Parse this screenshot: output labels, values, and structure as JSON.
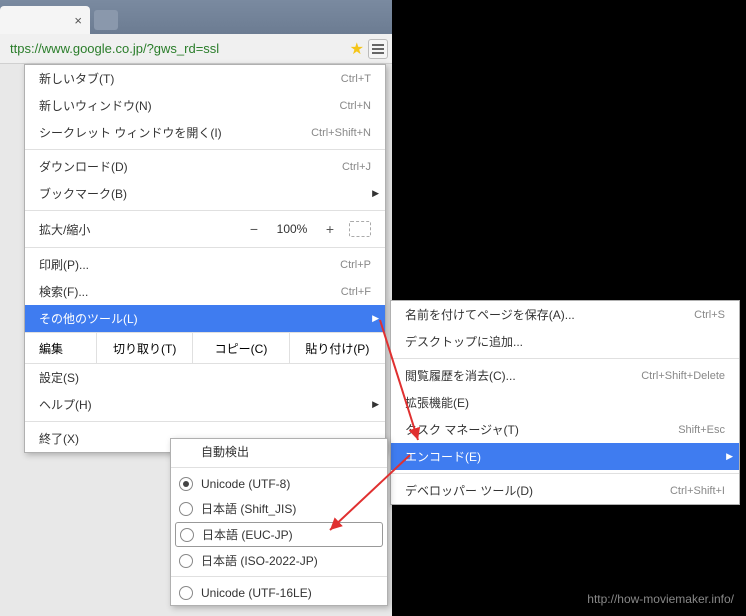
{
  "url": "ttps://www.google.co.jp/?gws_rd=ssl",
  "main_menu": {
    "new_tab": {
      "label": "新しいタブ(T)",
      "shortcut": "Ctrl+T"
    },
    "new_window": {
      "label": "新しいウィンドウ(N)",
      "shortcut": "Ctrl+N"
    },
    "incognito": {
      "label": "シークレット ウィンドウを開く(I)",
      "shortcut": "Ctrl+Shift+N"
    },
    "downloads": {
      "label": "ダウンロード(D)",
      "shortcut": "Ctrl+J"
    },
    "bookmarks": {
      "label": "ブックマーク(B)",
      "shortcut": ""
    },
    "zoom": {
      "label": "拡大/縮小",
      "minus": "−",
      "value": "100%",
      "plus": "+"
    },
    "print": {
      "label": "印刷(P)...",
      "shortcut": "Ctrl+P"
    },
    "find": {
      "label": "検索(F)...",
      "shortcut": "Ctrl+F"
    },
    "more_tools": {
      "label": "その他のツール(L)",
      "shortcut": ""
    },
    "edit": {
      "label": "編集",
      "cut": "切り取り(T)",
      "copy": "コピー(C)",
      "paste": "貼り付け(P)"
    },
    "settings": {
      "label": "設定(S)",
      "shortcut": ""
    },
    "help": {
      "label": "ヘルプ(H)",
      "shortcut": ""
    },
    "exit": {
      "label": "終了(X)",
      "shortcut": ""
    }
  },
  "sub_menu": {
    "save_as": {
      "label": "名前を付けてページを保存(A)...",
      "shortcut": "Ctrl+S"
    },
    "add_desktop": {
      "label": "デスクトップに追加...",
      "shortcut": ""
    },
    "clear_history": {
      "label": "閲覧履歴を消去(C)...",
      "shortcut": "Ctrl+Shift+Delete"
    },
    "extensions": {
      "label": "拡張機能(E)",
      "shortcut": ""
    },
    "task_manager": {
      "label": "タスク マネージャ(T)",
      "shortcut": "Shift+Esc"
    },
    "encoding": {
      "label": "エンコード(E)",
      "shortcut": ""
    },
    "dev_tools": {
      "label": "デベロッパー ツール(D)",
      "shortcut": "Ctrl+Shift+I"
    }
  },
  "encoding_menu": {
    "auto": "自動検出",
    "utf8": "Unicode (UTF-8)",
    "sjis": "日本語 (Shift_JIS)",
    "eucjp": "日本語 (EUC-JP)",
    "iso2022": "日本語 (ISO-2022-JP)",
    "utf16le": "Unicode (UTF-16LE)"
  },
  "watermark": "http://how-moviemaker.info/"
}
